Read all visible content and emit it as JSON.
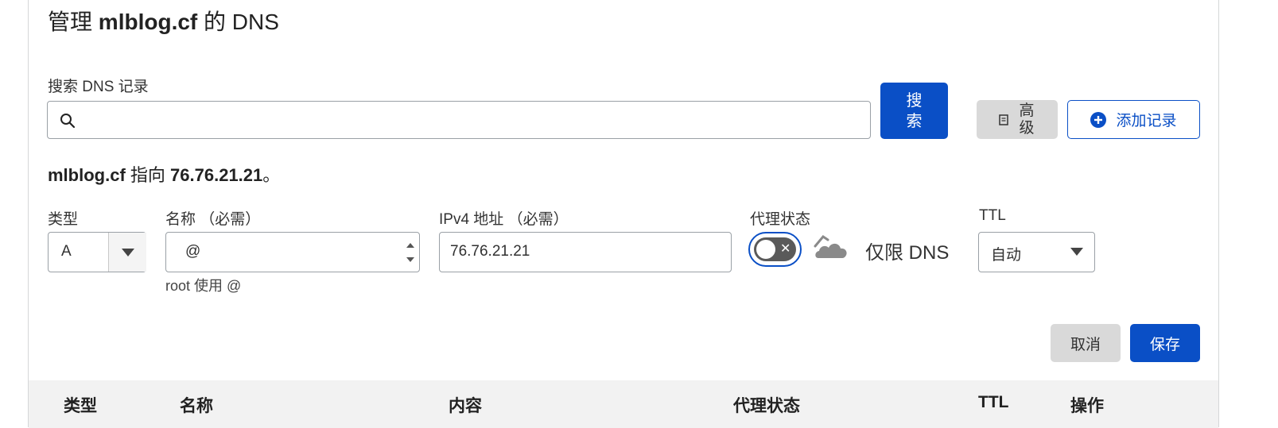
{
  "header": {
    "prefix": "管理",
    "domain": "mlblog.cf",
    "suffix": "的 DNS"
  },
  "search": {
    "label": "搜索 DNS 记录",
    "value": "",
    "button_label": "搜索",
    "icon": "search-icon"
  },
  "toolbar": {
    "advanced_label": "高级",
    "advanced_icon": "document-icon",
    "add_record_label": "添加记录",
    "add_record_icon": "plus-circle-icon"
  },
  "points_to": {
    "domain": "mlblog.cf",
    "middle": "指向",
    "ip": "76.76.21.21",
    "end": "。"
  },
  "form": {
    "type": {
      "label": "类型",
      "value": "A"
    },
    "name": {
      "label": "名称 （必需）",
      "value": "@",
      "hint": "root 使用 @"
    },
    "ipv4": {
      "label": "IPv4 地址 （必需）",
      "value": "76.76.21.21"
    },
    "proxy": {
      "label": "代理状态",
      "enabled": false,
      "status_text": "仅限 DNS",
      "icon": "cloud-icon"
    },
    "ttl": {
      "label": "TTL",
      "value": "自动"
    }
  },
  "actions": {
    "cancel_label": "取消",
    "save_label": "保存"
  },
  "table": {
    "columns": [
      "类型",
      "名称",
      "内容",
      "代理状态",
      "TTL",
      "操作"
    ]
  },
  "colors": {
    "primary": "#0a4fc6",
    "secondary_button": "#d9d9d9",
    "toggle_off": "#5a5a5a"
  }
}
